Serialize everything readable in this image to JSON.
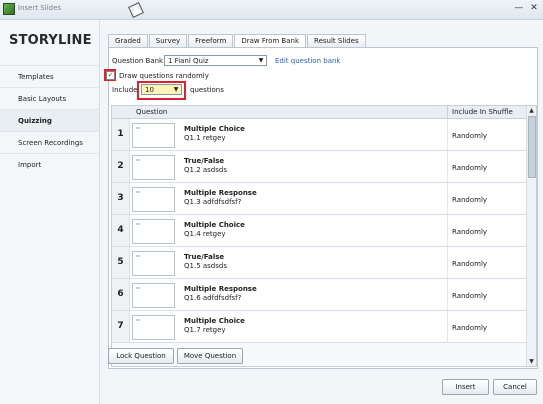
{
  "window": {
    "title": "Insert Slides"
  },
  "sidebar": {
    "brand": "STORYLINE",
    "items": [
      {
        "label": "Templates"
      },
      {
        "label": "Basic Layouts"
      },
      {
        "label": "Quizzing"
      },
      {
        "label": "Screen Recordings"
      },
      {
        "label": "Import"
      }
    ]
  },
  "tabs": [
    {
      "label": "Graded"
    },
    {
      "label": "Survey"
    },
    {
      "label": "Freeform"
    },
    {
      "label": "Draw From Bank"
    },
    {
      "label": "Result Slides"
    }
  ],
  "bank": {
    "label": "Question Bank:",
    "selected": "1 Fianl Quiz",
    "edit_link": "Edit question bank",
    "draw_randomly_label": "Draw questions randomly",
    "draw_randomly_checked": true,
    "include_label": "Include:",
    "include_value": "10",
    "include_suffix": "questions"
  },
  "grid": {
    "headers": {
      "question": "Question",
      "shuffle": "Include In Shuffle"
    },
    "rows": [
      {
        "num": "1",
        "type": "Multiple Choice",
        "text": "Q1.1 retgey",
        "shuffle": "Randomly"
      },
      {
        "num": "2",
        "type": "True/False",
        "text": "Q1.2 asdsds",
        "shuffle": "Randomly"
      },
      {
        "num": "3",
        "type": "Multiple Response",
        "text": "Q1.3 adfdfsdfsf?",
        "shuffle": "Randomly"
      },
      {
        "num": "4",
        "type": "Multiple Choice",
        "text": "Q1.4 retgey",
        "shuffle": "Randomly"
      },
      {
        "num": "5",
        "type": "True/False",
        "text": "Q1.5 asdsds",
        "shuffle": "Randomly"
      },
      {
        "num": "6",
        "type": "Multiple Response",
        "text": "Q1.6 adfdfsdfsf?",
        "shuffle": "Randomly"
      },
      {
        "num": "7",
        "type": "Multiple Choice",
        "text": "Q1.7 retgey",
        "shuffle": "Randomly"
      }
    ]
  },
  "buttons": {
    "lock": "Lock Question",
    "move": "Move Question",
    "insert": "Insert",
    "cancel": "Cancel"
  },
  "icons": {
    "minimize": "minimize-icon",
    "close": "close-icon",
    "dropdown": "chevron-down-icon",
    "check": "checkmark-icon"
  },
  "colors": {
    "highlight": "#d9232d",
    "link": "#2a62b8",
    "accent_green": "#6bb34a"
  }
}
